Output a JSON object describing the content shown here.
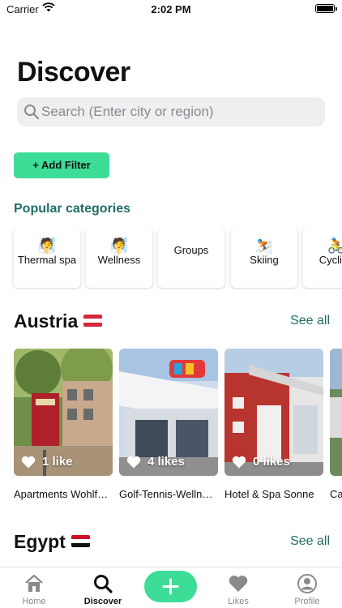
{
  "status_bar": {
    "carrier": "Carrier",
    "time": "2:02 PM"
  },
  "header": {
    "title": "Discover"
  },
  "search": {
    "placeholder": "Search (Enter city or region)"
  },
  "filters": {
    "add_label": "+ Add Filter"
  },
  "categories": {
    "title": "Popular categories",
    "items": [
      {
        "emoji": "🧖",
        "label": "Thermal spa"
      },
      {
        "emoji": "🧖",
        "label": "Wellness"
      },
      {
        "emoji": "",
        "label": "Groups"
      },
      {
        "emoji": "⛷️",
        "label": "Skiing"
      },
      {
        "emoji": "🚴",
        "label": "Cycling"
      }
    ]
  },
  "regions": [
    {
      "title": "Austria",
      "see_all": "See all",
      "hotels": [
        {
          "name": "Apartments Wohlfühlgarten",
          "likes": "1 like"
        },
        {
          "name": "Golf-Tennis-Wellness-Hotel",
          "likes": "4 likes"
        },
        {
          "name": "Hotel & Spa Sonne",
          "likes": "0 likes"
        },
        {
          "name": "Ca",
          "likes": ""
        }
      ]
    },
    {
      "title": "Egypt",
      "see_all": "See all"
    }
  ],
  "tab_bar": {
    "items": [
      {
        "label": "Home",
        "icon": "house-icon"
      },
      {
        "label": "Discover",
        "icon": "search-icon"
      },
      {
        "label": "",
        "icon": "plus-icon"
      },
      {
        "label": "Likes",
        "icon": "heart-icon"
      },
      {
        "label": "Profile",
        "icon": "person-icon"
      }
    ]
  },
  "colors": {
    "accent": "#3ddc97",
    "teal_text": "#1f6e66",
    "search_bg": "#eeeff1"
  }
}
